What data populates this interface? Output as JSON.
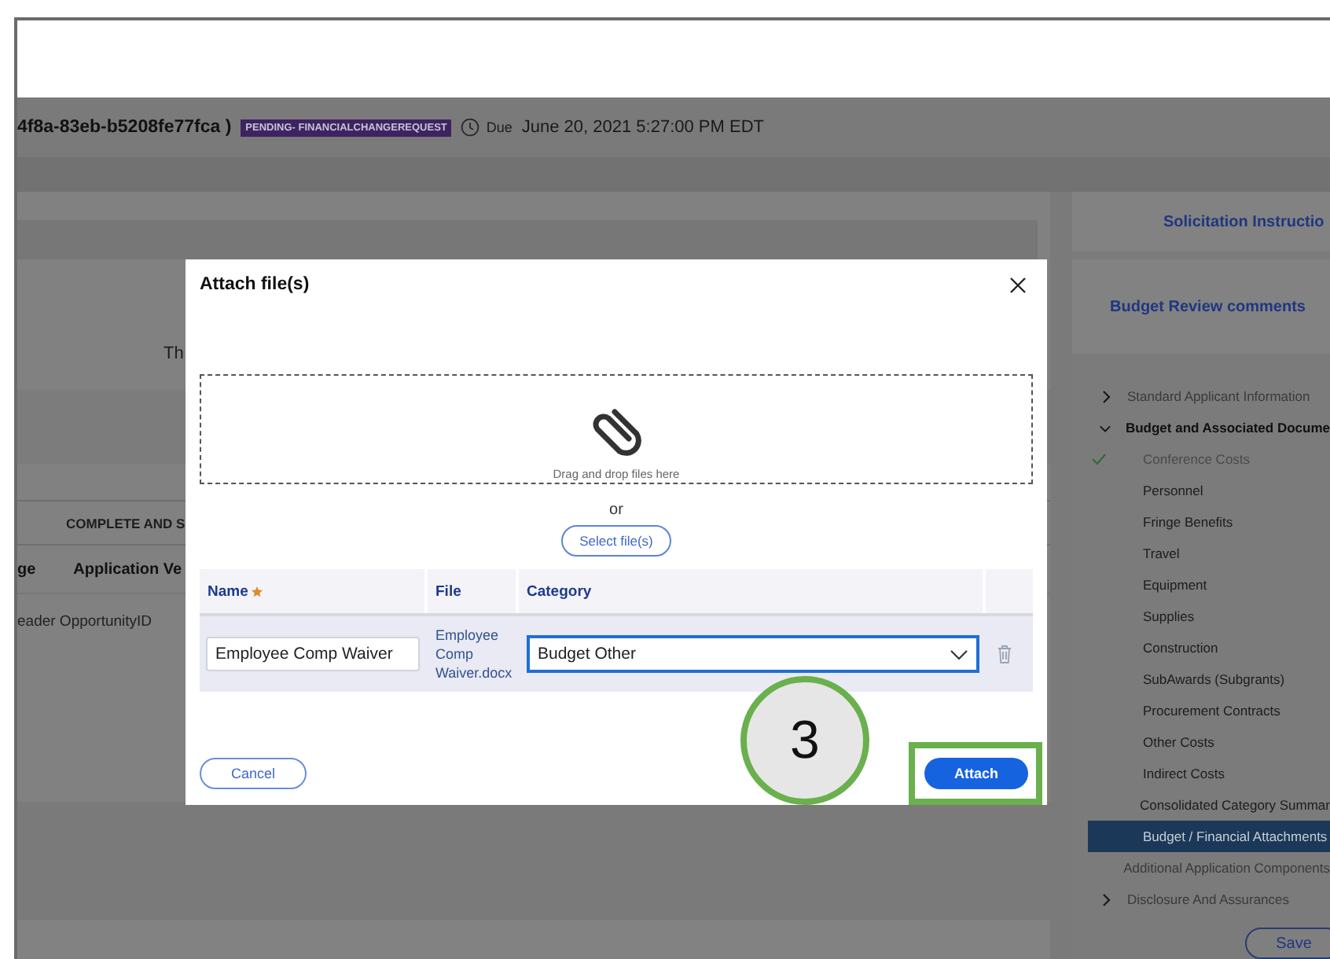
{
  "header": {
    "request_id": "4f8a-83eb-b5208fe77fca )",
    "status_badge": "PENDING- FINANCIALCHANGEREQUEST",
    "due_label": "Due",
    "due_date": "June 20, 2021 5:27:00 PM EDT"
  },
  "main_panel": {
    "text_fragment": "Th",
    "tab": "COMPLETE AND S",
    "columns": [
      "ge",
      "Application Ve"
    ],
    "row_text": "eader OpportunityID"
  },
  "side_cards": [
    "Solicitation Instructio",
    "Budget Review comments"
  ],
  "nav": [
    {
      "label": "Standard Applicant Information",
      "kind": "section",
      "expanded": false,
      "selected": false
    },
    {
      "label": "Budget and Associated Docume",
      "kind": "section",
      "expanded": true,
      "selected": false,
      "children": [
        {
          "label": "Conference Costs",
          "checked": true,
          "selected": false
        },
        {
          "label": "Personnel",
          "checked": false,
          "selected": false
        },
        {
          "label": "Fringe Benefits",
          "checked": false,
          "selected": false
        },
        {
          "label": "Travel",
          "checked": false,
          "selected": false
        },
        {
          "label": "Equipment",
          "checked": false,
          "selected": false
        },
        {
          "label": "Supplies",
          "checked": false,
          "selected": false
        },
        {
          "label": "Construction",
          "checked": false,
          "selected": false
        },
        {
          "label": "SubAwards (Subgrants)",
          "checked": false,
          "selected": false
        },
        {
          "label": "Procurement Contracts",
          "checked": false,
          "selected": false
        },
        {
          "label": "Other Costs",
          "checked": false,
          "selected": false
        },
        {
          "label": "Indirect Costs",
          "checked": false,
          "selected": false
        },
        {
          "label": "Consolidated Category Summar",
          "checked": false,
          "selected": false
        },
        {
          "label": "Budget / Financial Attachments",
          "checked": false,
          "selected": true
        }
      ]
    },
    {
      "label": "Additional Application Components",
      "kind": "page",
      "selected": false
    },
    {
      "label": "Disclosure And Assurances",
      "kind": "section",
      "expanded": false,
      "selected": false
    }
  ],
  "save_button": "Save",
  "dialog": {
    "title": "Attach file(s)",
    "dropzone_text": "Drag and drop files here",
    "or_text": "or",
    "select_button": "Select file(s)",
    "columns": [
      {
        "label": "Name",
        "required": true
      },
      {
        "label": "File",
        "required": false
      },
      {
        "label": "Category",
        "required": false
      }
    ],
    "rows": [
      {
        "name": "Employee Comp Waiver",
        "file": "Employee Comp Waiver.docx",
        "category": "Budget Other"
      }
    ],
    "cancel_button": "Cancel",
    "attach_button": "Attach"
  },
  "callout": {
    "label": "3"
  }
}
